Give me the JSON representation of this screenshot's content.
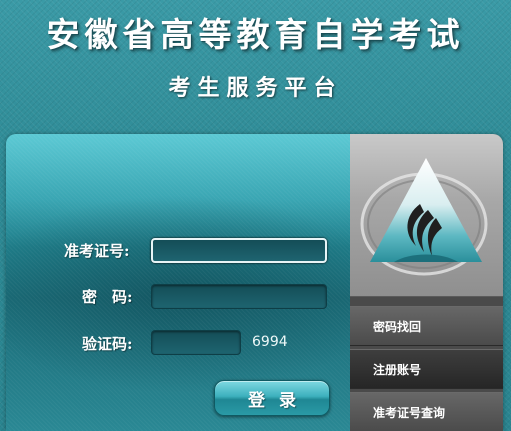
{
  "header": {
    "title": "安徽省高等教育自学考试",
    "subtitle": "考生服务平台"
  },
  "login": {
    "exam_id_label": "准考证号:",
    "exam_id_value": "",
    "password_label": "密　码:",
    "password_value": "",
    "captcha_label": "验证码:",
    "captcha_value": "",
    "captcha_code": "6994",
    "submit_label": "登录"
  },
  "sidebar": {
    "links": [
      {
        "label": "密码找回"
      },
      {
        "label": "注册账号"
      },
      {
        "label": "准考证号查询"
      }
    ]
  },
  "colors": {
    "background": "#2f8d98",
    "panel_accent": "#3aa6b3",
    "sidebar": "#4a4a4a"
  }
}
